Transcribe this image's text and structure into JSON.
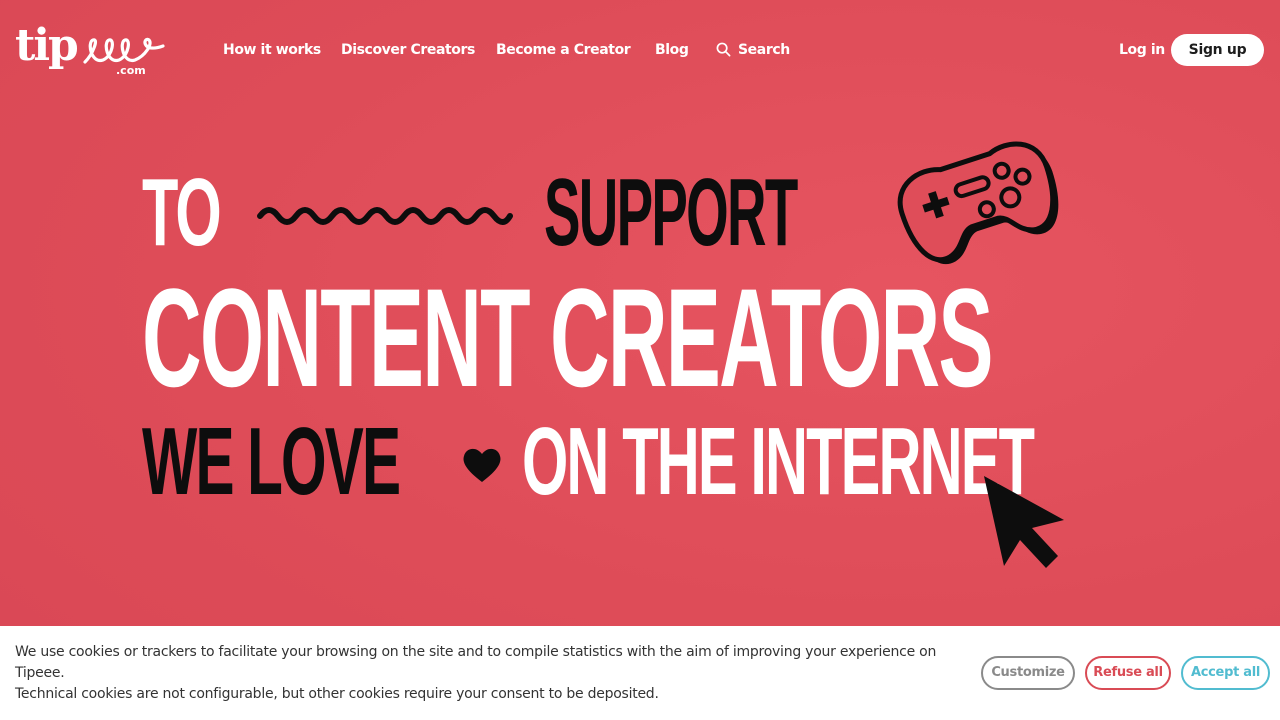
{
  "logo": {
    "word": "tip",
    "suffix": ".com"
  },
  "nav": {
    "items": [
      "How it works",
      "Discover Creators",
      "Become a Creator",
      "Blog"
    ],
    "search_label": "Search"
  },
  "auth": {
    "login_label": "Log in",
    "signup_label": "Sign up"
  },
  "headline": {
    "line1_left": "TO",
    "line1_right": "SUPPORT",
    "line2": "CONTENT CREATORS",
    "line3_left": "WE LOVE",
    "line3_right": "ON THE INTERNET"
  },
  "cookie_banner": {
    "text_line1": "We use cookies or trackers to facilitate your browsing on the site and to compile statistics with the aim of improving your experience on Tipeee.",
    "text_line2": "Technical cookies are not configurable, but other cookies require your consent to be deposited.",
    "customize_label": "Customize",
    "refuse_label": "Refuse all",
    "accept_label": "Accept all"
  },
  "colors": {
    "background": "#df4d59",
    "refuse": "#d94b55",
    "accept": "#51bcd0",
    "customize": "#8a8a8a"
  },
  "icons": [
    "search-icon",
    "gamepad-icon",
    "heart-icon",
    "cursor-arrow-icon",
    "squiggle-line-icon"
  ]
}
